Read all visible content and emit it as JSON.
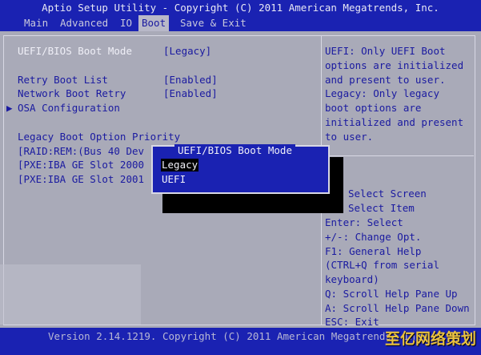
{
  "title": "Aptio Setup Utility - Copyright (C) 2011 American Megatrends, Inc.",
  "menu": [
    "Main",
    "Advanced",
    "IO",
    "Boot",
    "Save & Exit"
  ],
  "menu_active_index": 3,
  "settings": {
    "uefi_bios_mode": {
      "label": "UEFI/BIOS Boot Mode",
      "value": "[Legacy]"
    },
    "retry_boot": {
      "label": "Retry Boot List",
      "value": "[Enabled]"
    },
    "network_retry": {
      "label": "Network Boot Retry",
      "value": "[Enabled]"
    },
    "osa": {
      "arrow": "▶",
      "label": "OSA Configuration"
    },
    "legacy_heading": "Legacy Boot Option Priority",
    "options": [
      "[RAID:REM:(Bus 40 Dev",
      "[PXE:IBA GE Slot 2000",
      "[PXE:IBA GE Slot 2001"
    ]
  },
  "help_text": [
    "UEFI: Only UEFI Boot",
    "options are initialized",
    "and present to user.",
    "Legacy: Only legacy",
    "boot options are",
    "initialized and present",
    "to user."
  ],
  "keys": [
    "Select Screen",
    "Select Item",
    "Enter: Select",
    "+/-: Change Opt.",
    "F1: General Help",
    "(CTRL+Q from serial",
    "keyboard)",
    "Q: Scroll Help Pane Up",
    "A: Scroll Help Pane Down",
    "ESC: Exit"
  ],
  "popup": {
    "title": "UEFI/BIOS Boot Mode",
    "options": [
      "Legacy",
      "UEFI"
    ],
    "selected_index": 0
  },
  "footer": "Version 2.14.1219. Copyright (C) 2011 American Megatrends, Inc.",
  "watermark": "至亿网络策划"
}
